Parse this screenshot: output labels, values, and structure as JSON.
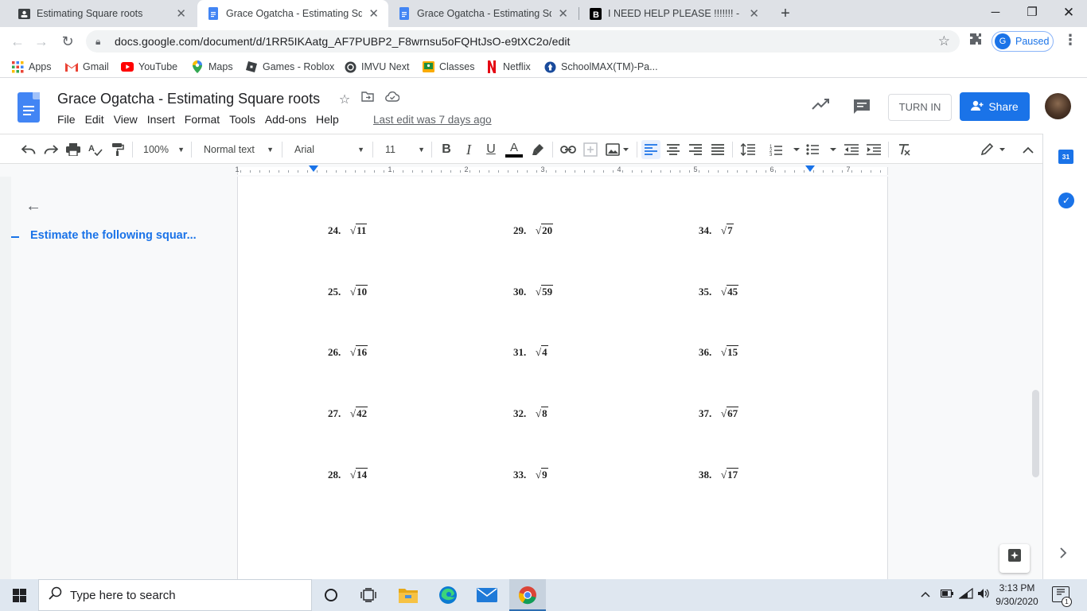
{
  "browser": {
    "tabs": [
      {
        "title": "Estimating Square roots",
        "favicon": "classroom-icon"
      },
      {
        "title": "Grace Ogatcha - Estimating Squa",
        "favicon": "docs-icon"
      },
      {
        "title": "Grace Ogatcha - Estimating Squa",
        "favicon": "docs-icon"
      },
      {
        "title": "I NEED HELP PLEASE !!!!!!! - Brain",
        "favicon": "brainly-icon"
      }
    ],
    "url": "docs.google.com/document/d/1RR5IKAatg_AF7PUBP2_F8wrnsu5oFQHtJsO-e9tXC2o/edit",
    "profile_initial": "G",
    "profile_status": "Paused",
    "bookmarks": [
      {
        "label": "Apps",
        "icon": "apps-grid-icon"
      },
      {
        "label": "Gmail",
        "icon": "gmail-icon"
      },
      {
        "label": "YouTube",
        "icon": "youtube-icon"
      },
      {
        "label": "Maps",
        "icon": "maps-icon"
      },
      {
        "label": "Games - Roblox",
        "icon": "roblox-icon"
      },
      {
        "label": "IMVU Next",
        "icon": "imvu-icon"
      },
      {
        "label": "Classes",
        "icon": "classes-icon"
      },
      {
        "label": "Netflix",
        "icon": "netflix-icon"
      },
      {
        "label": "SchoolMAX(TM)-Pa...",
        "icon": "schoolmax-icon"
      }
    ]
  },
  "docs": {
    "title": "Grace Ogatcha - Estimating Square roots",
    "menu": [
      "File",
      "Edit",
      "View",
      "Insert",
      "Format",
      "Tools",
      "Add-ons",
      "Help"
    ],
    "last_edit": "Last edit was 7 days ago",
    "turn_in": "TURN IN",
    "share": "Share",
    "toolbar": {
      "zoom": "100%",
      "style": "Normal text",
      "font": "Arial",
      "size": "11"
    },
    "ruler_numbers": [
      "1",
      "1",
      "2",
      "3",
      "4",
      "5",
      "6",
      "7"
    ],
    "outline": {
      "heading": "Estimate the following squar..."
    },
    "problems": [
      {
        "num": "24.",
        "radicand": "11"
      },
      {
        "num": "25.",
        "radicand": "10"
      },
      {
        "num": "26.",
        "radicand": "16"
      },
      {
        "num": "27.",
        "radicand": "42"
      },
      {
        "num": "28.",
        "radicand": "14"
      },
      {
        "num": "29.",
        "radicand": "20"
      },
      {
        "num": "30.",
        "radicand": "59"
      },
      {
        "num": "31.",
        "radicand": "4"
      },
      {
        "num": "32.",
        "radicand": "8"
      },
      {
        "num": "33.",
        "radicand": "9"
      },
      {
        "num": "34.",
        "radicand": "7"
      },
      {
        "num": "35.",
        "radicand": "45"
      },
      {
        "num": "36.",
        "radicand": "15"
      },
      {
        "num": "37.",
        "radicand": "67"
      },
      {
        "num": "38.",
        "radicand": "17"
      }
    ],
    "calendar_day": "31"
  },
  "taskbar": {
    "search_placeholder": "Type here to search",
    "time": "3:13 PM",
    "date": "9/30/2020",
    "notification_count": "1"
  },
  "colors": {
    "accent": "#1a73e8",
    "docs_blue": "#4285f4"
  }
}
